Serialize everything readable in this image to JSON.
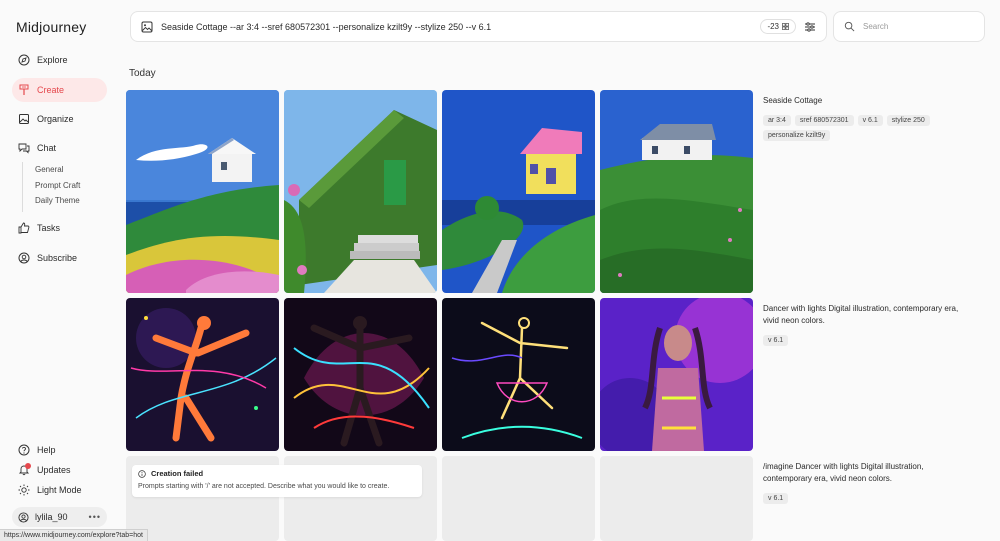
{
  "brand": "Midjourney",
  "nav": {
    "explore": "Explore",
    "create": "Create",
    "organize": "Organize",
    "chat": "Chat",
    "chat_sub": [
      "General",
      "Prompt Craft",
      "Daily Theme"
    ],
    "tasks": "Tasks",
    "subscribe": "Subscribe",
    "help": "Help",
    "updates": "Updates",
    "light_mode": "Light Mode",
    "username": "lylila_90",
    "more": "•••"
  },
  "prompt_bar": {
    "text": "Seaside Cottage --ar 3:4 --sref 680572301 --personalize kzilt9y --stylize 250 --v 6.1",
    "count": "-23"
  },
  "search": {
    "placeholder": "Search"
  },
  "section_title": "Today",
  "rows": [
    {
      "title": "Seaside Cottage",
      "tags": [
        "ar 3:4",
        "sref 680572301",
        "v 6.1",
        "stylize 250",
        "personalize kzilt9y"
      ]
    },
    {
      "title": "Dancer with lights Digital illustration, contemporary era, vivid neon colors.",
      "tags": [
        "v 6.1"
      ]
    },
    {
      "title": "/imagine Dancer with lights Digital illustration, contemporary era, vivid neon colors.",
      "tags": [
        "v 6.1"
      ]
    }
  ],
  "error": {
    "title": "Creation failed",
    "message": "Prompts starting with '/' are not accepted. Describe what you would like to create."
  },
  "status_url": "https://www.midjourney.com/explore?tab=hot",
  "colors": {
    "accent": "#e5484d",
    "active_bg": "#fde8e8"
  }
}
